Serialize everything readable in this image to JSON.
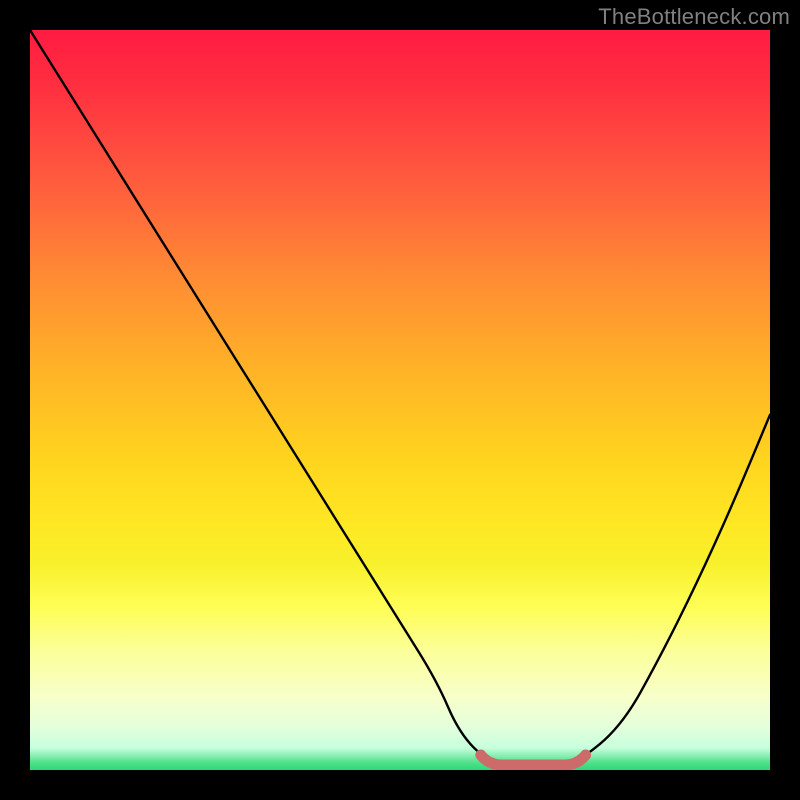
{
  "attribution": "TheBottleneck.com",
  "colors": {
    "frame_bg": "#000000",
    "curve_stroke": "#000000",
    "bottom_marker": "#cd6b6a"
  },
  "chart_data": {
    "type": "line",
    "title": "",
    "xlabel": "",
    "ylabel": "",
    "xlim": [
      0,
      100
    ],
    "ylim": [
      0,
      100
    ],
    "x": [
      0,
      5,
      10,
      15,
      20,
      25,
      30,
      35,
      40,
      45,
      50,
      55,
      58,
      62,
      66,
      70,
      74,
      80,
      85,
      90,
      95,
      100
    ],
    "values": [
      100,
      92,
      84,
      76,
      68,
      60,
      52,
      44,
      36,
      28,
      20,
      12,
      5,
      1,
      0,
      0,
      1,
      6,
      15,
      25,
      36,
      48
    ],
    "annotations": [
      {
        "type": "flat_segment",
        "x_start": 62,
        "x_end": 74,
        "y": 0
      }
    ],
    "grid": false,
    "legend": null,
    "background_gradient_top": "#ff1b42",
    "background_gradient_bottom": "#2ed978"
  }
}
